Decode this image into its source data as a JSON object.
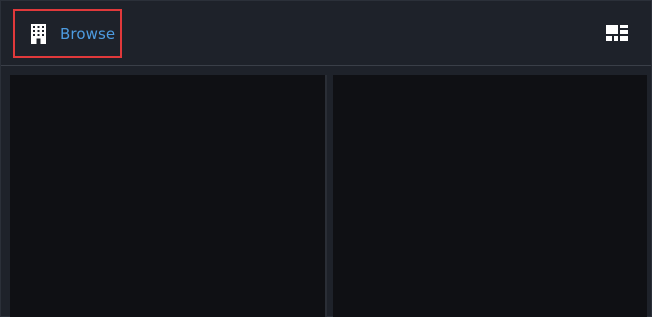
{
  "header": {
    "browse_label": "Browse",
    "browse_icon": "building-icon",
    "layout_icon": "layout-grid-icon"
  },
  "colors": {
    "background": "#1e222a",
    "panel": "#0f1014",
    "accent_text": "#4d9be0",
    "highlight_border": "#e0393b"
  }
}
